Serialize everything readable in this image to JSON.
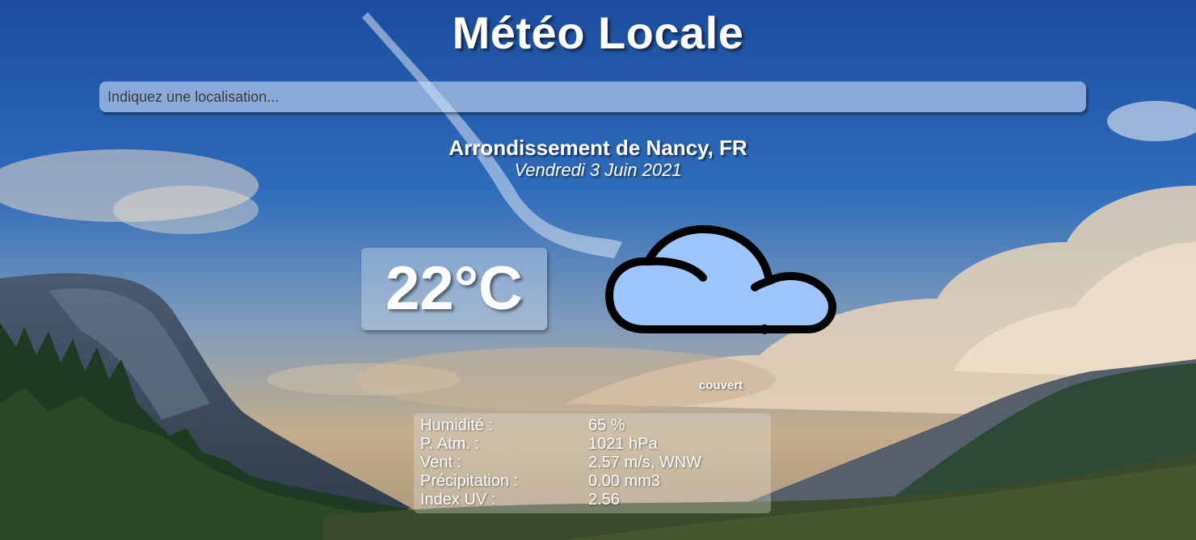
{
  "header": {
    "title": "Météo Locale"
  },
  "search": {
    "placeholder": "Indiquez une localisation...",
    "value": ""
  },
  "location": {
    "name": "Arrondissement de Nancy, FR",
    "date": "Vendredi 3 Juin 2021"
  },
  "current": {
    "temperature": "22°C",
    "condition": "couvert",
    "icon": "cloud-icon"
  },
  "details": [
    {
      "label": "Humidité :",
      "value": "65 %"
    },
    {
      "label": "P. Atm. :",
      "value": "1021 hPa"
    },
    {
      "label": "Vent :",
      "value": "2.57 m/s, WNW"
    },
    {
      "label": "Précipitation :",
      "value": "0.00 mm3"
    },
    {
      "label": "Index UV :",
      "value": "2.56"
    }
  ],
  "colors": {
    "cloud_fill": "#9ec5ff",
    "cloud_stroke": "#000000",
    "text": "#ffffff",
    "sky_top": "#1f4fa0"
  }
}
